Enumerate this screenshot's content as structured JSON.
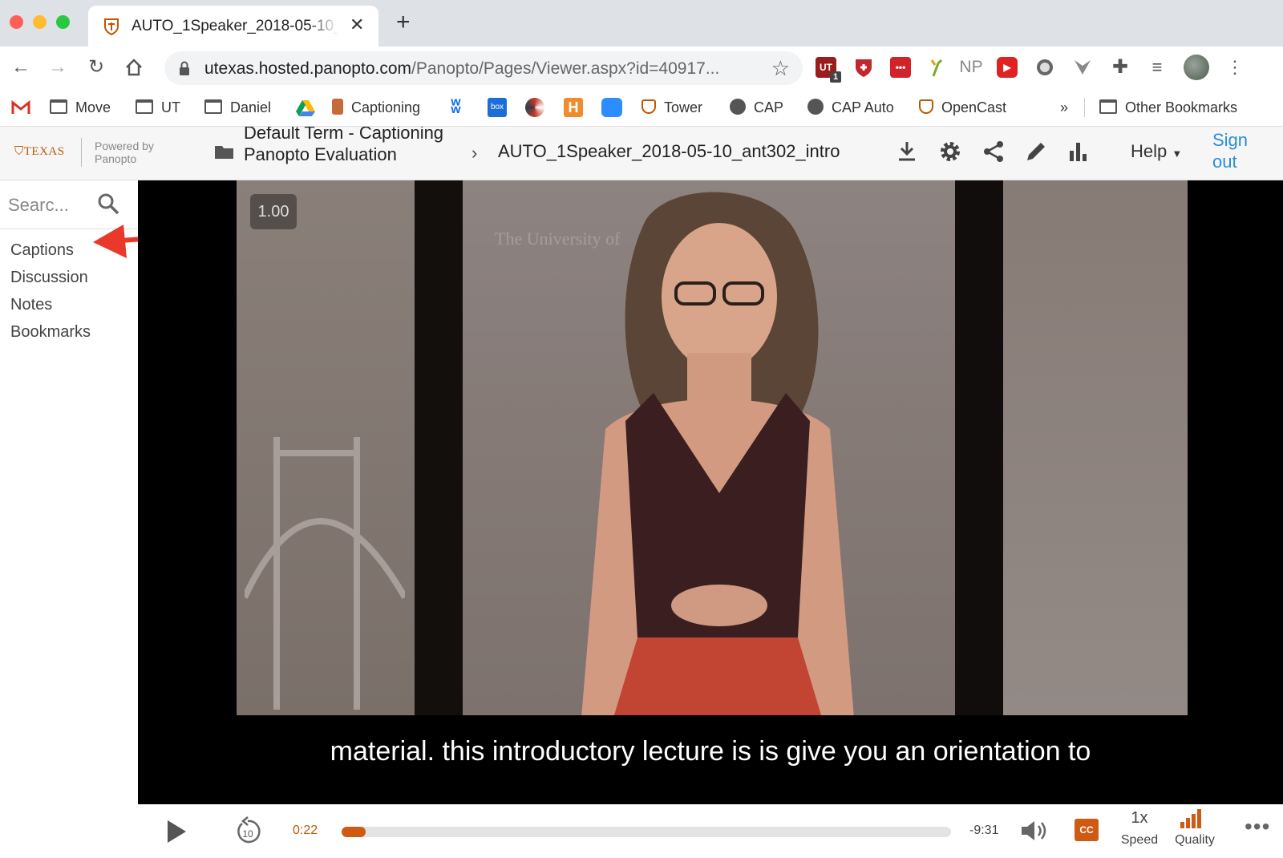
{
  "browser": {
    "tab_title": "AUTO_1Speaker_2018-05-10_ant302_intro",
    "url_host": "utexas.hosted.panopto.com",
    "url_path": "/Panopto/Pages/Viewer.aspx?id=40917...",
    "extension_badge": "1",
    "np_label": "NP",
    "bookmarks": [
      "Move",
      "UT",
      "Daniel",
      "Captioning",
      "Tower",
      "CAP",
      "CAP Auto",
      "OpenCast"
    ],
    "bookmarks_overflow": "»",
    "other_bookmarks": "Other Bookmarks"
  },
  "header": {
    "logo_text": "TEXAS",
    "powered_by_line1": "Powered by",
    "powered_by_line2": "Panopto",
    "folder_text": "Default Term - Captioning Panopto Evaluation",
    "breadcrumb_sep": "›",
    "session_title": "AUTO_1Speaker_2018-05-10_ant302_intro",
    "help_label": "Help",
    "sign_out_label": "Sign out",
    "brand_color": "#bf5700",
    "link_color": "#2a8fd6"
  },
  "sidebar": {
    "search_placeholder": "Searc...",
    "items": [
      "Captions",
      "Discussion",
      "Notes",
      "Bookmarks"
    ]
  },
  "video": {
    "speed_badge": "1.00",
    "watermark": "The University of",
    "caption": "material. this introductory lecture is is give you an orientation to"
  },
  "player": {
    "current_time": "0:22",
    "remaining_time": "-9:31",
    "progress_fraction": 0.04,
    "cc_label": "CC",
    "speed_value": "1x",
    "speed_label": "Speed",
    "quality_label": "Quality",
    "rewind_seconds": "10",
    "accent_color": "#cf5a14"
  }
}
